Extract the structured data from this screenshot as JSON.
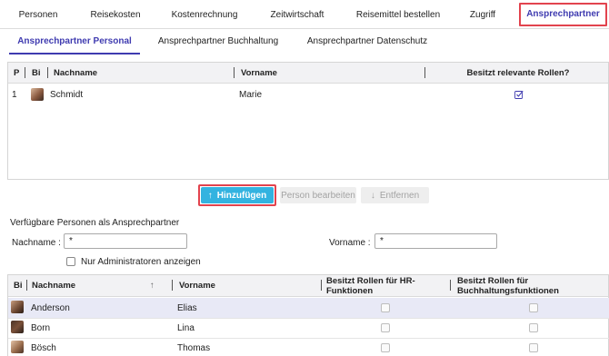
{
  "top_tabs": [
    "Personen",
    "Reisekosten",
    "Kostenrechnung",
    "Zeitwirtschaft",
    "Reisemittel bestellen",
    "Zugriff",
    "Ansprechpartner"
  ],
  "sub_tabs": [
    "Ansprechpartner Personal",
    "Ansprechpartner Buchhaltung",
    "Ansprechpartner Datenschutz"
  ],
  "contacts_grid": {
    "headers": {
      "pos": "P",
      "bild": "Bi",
      "nachname": "Nachname",
      "vorname": "Vorname",
      "rollen": "Besitzt relevante Rollen?"
    },
    "rows": [
      {
        "pos": "1",
        "nachname": "Schmidt",
        "vorname": "Marie",
        "has_roles": true
      }
    ]
  },
  "buttons": {
    "add": "Hinzufügen",
    "edit": "Person bearbeiten",
    "remove": "Entfernen"
  },
  "available": {
    "title": "Verfügbare Personen als Ansprechpartner",
    "nachname_label": "Nachname :",
    "nachname_value": "*",
    "vorname_label": "Vorname :",
    "vorname_value": "*",
    "admins_only_label": "Nur Administratoren anzeigen"
  },
  "people_grid": {
    "headers": {
      "bild": "Bi",
      "nachname": "Nachname",
      "vorname": "Vorname",
      "hr": "Besitzt Rollen für HR-Funktionen",
      "buch": "Besitzt Rollen für Buchhaltungsfunktionen"
    },
    "rows": [
      {
        "nachname": "Anderson",
        "vorname": "Elias"
      },
      {
        "nachname": "Born",
        "vorname": "Lina"
      },
      {
        "nachname": "Bösch",
        "vorname": "Thomas"
      }
    ]
  },
  "colors": {
    "accent": "#3f3bb0",
    "highlight": "#e2434e",
    "primary_button": "#33b3e0"
  }
}
